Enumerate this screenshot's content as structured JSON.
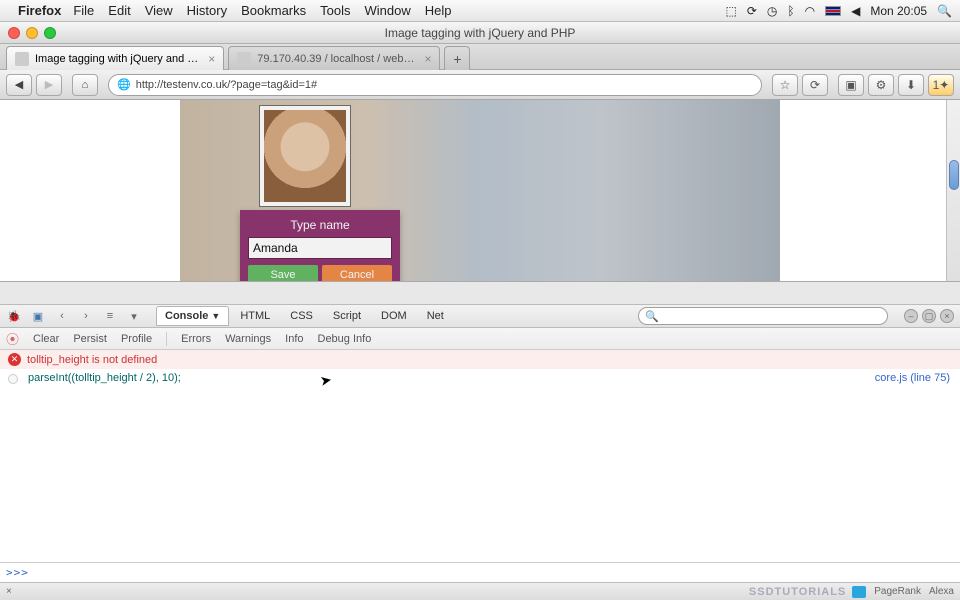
{
  "menubar": {
    "app": "Firefox",
    "items": [
      "File",
      "Edit",
      "View",
      "History",
      "Bookmarks",
      "Tools",
      "Window",
      "Help"
    ],
    "clock": "Mon 20:05"
  },
  "window": {
    "title": "Image tagging with jQuery and PHP"
  },
  "tabs": [
    {
      "label": "Image tagging with jQuery and …",
      "active": true
    },
    {
      "label": "79.170.40.39 / localhost / web…",
      "active": false
    }
  ],
  "url": "http://testenv.co.uk/?page=tag&id=1#",
  "tagger": {
    "prompt": "Type name",
    "value": "Amanda",
    "save": "Save",
    "cancel": "Cancel"
  },
  "firebug": {
    "panels": [
      "Console",
      "HTML",
      "CSS",
      "Script",
      "DOM",
      "Net"
    ],
    "active_panel": "Console",
    "subbar": {
      "clear": "Clear",
      "persist": "Persist",
      "profile": "Profile",
      "errors": "Errors",
      "warnings": "Warnings",
      "info": "Info",
      "debuginfo": "Debug Info"
    },
    "error": "tolltip_height is not defined",
    "code": "parseInt((tolltip_height / 2), 10);",
    "source": "core.js (line 75)",
    "prompt": ">>>"
  },
  "statusbar": {
    "brand": "SSDTUTORIALS",
    "pagerank": "PageRank",
    "alexa": "Alexa"
  }
}
